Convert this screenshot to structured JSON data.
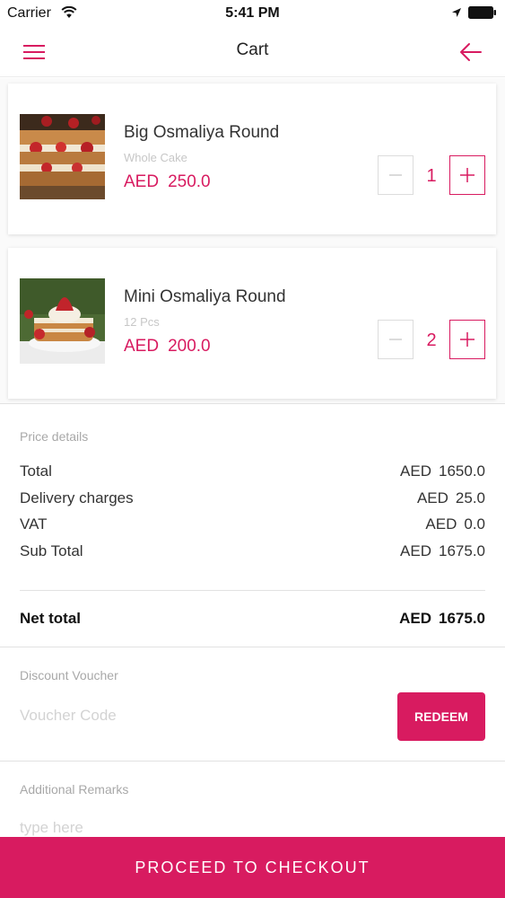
{
  "status_bar": {
    "carrier": "Carrier",
    "time": "5:41 PM"
  },
  "nav": {
    "title": "Cart",
    "menu_icon": "hamburger-menu-icon",
    "back_icon": "arrow-left-icon"
  },
  "colors": {
    "accent": "#d81b60",
    "muted_text": "#a8a8a8",
    "divider": "#e2e2e2"
  },
  "cart": {
    "items": [
      {
        "name": "Big Osmaliya Round",
        "variant": "Whole Cake",
        "currency": "AED",
        "price": "250.0",
        "quantity": "1"
      },
      {
        "name": "Mini Osmaliya Round",
        "variant": "12 Pcs",
        "currency": "AED",
        "price": "200.0",
        "quantity": "2"
      }
    ]
  },
  "price_details": {
    "label": "Price details",
    "rows": [
      {
        "label": "Total",
        "currency": "AED",
        "value": "1650.0"
      },
      {
        "label": "Delivery charges",
        "currency": "AED",
        "value": "25.0"
      },
      {
        "label": "VAT",
        "currency": "AED",
        "value": "0.0"
      },
      {
        "label": "Sub Total",
        "currency": "AED",
        "value": "1675.0"
      }
    ],
    "net_total": {
      "label": "Net total",
      "currency": "AED",
      "value": "1675.0"
    }
  },
  "voucher": {
    "label": "Discount Voucher",
    "placeholder": "Voucher Code",
    "value": "",
    "redeem_label": "REDEEM"
  },
  "remarks": {
    "label": "Additional Remarks",
    "placeholder": "type here",
    "value": ""
  },
  "checkout": {
    "label": "PROCEED TO CHECKOUT"
  }
}
